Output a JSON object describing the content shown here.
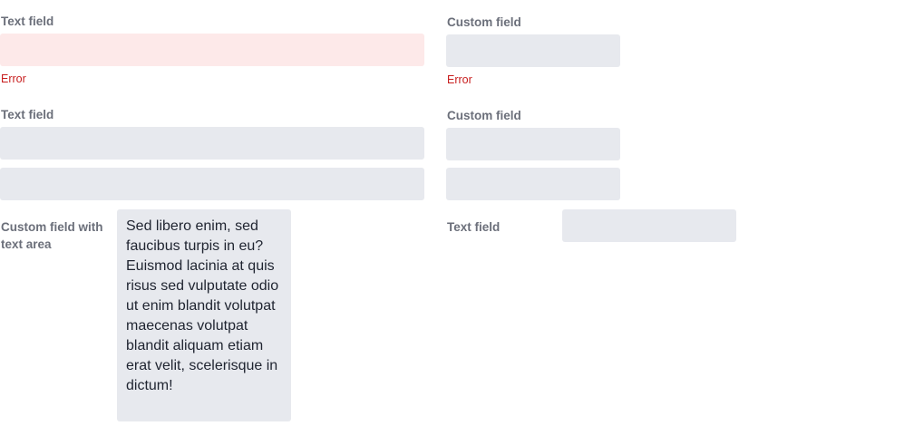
{
  "form": {
    "left": {
      "error_field": {
        "label": "Text field",
        "value": "",
        "error": "Error"
      },
      "multi_field": {
        "label": "Text field",
        "value_1": "",
        "value_2": ""
      },
      "textarea_field": {
        "label": "Custom field with text area",
        "value": "Sed libero enim, sed faucibus turpis in eu? Euismod lacinia at quis risus sed vulputate odio ut enim blandit volutpat maecenas volutpat blandit aliquam etiam erat velit, scelerisque in dictum!"
      }
    },
    "right": {
      "error_field": {
        "label": "Custom field",
        "value": "",
        "error": "Error"
      },
      "multi_field": {
        "label": "Custom field",
        "value_1": "",
        "value_2": ""
      },
      "inline_field": {
        "label": "Text field",
        "value": ""
      }
    }
  },
  "colors": {
    "field_bg": "#e7e9ee",
    "field_error_bg": "#fde9e9",
    "error_text": "#c81e1e",
    "label_text": "#6b6f7a"
  }
}
